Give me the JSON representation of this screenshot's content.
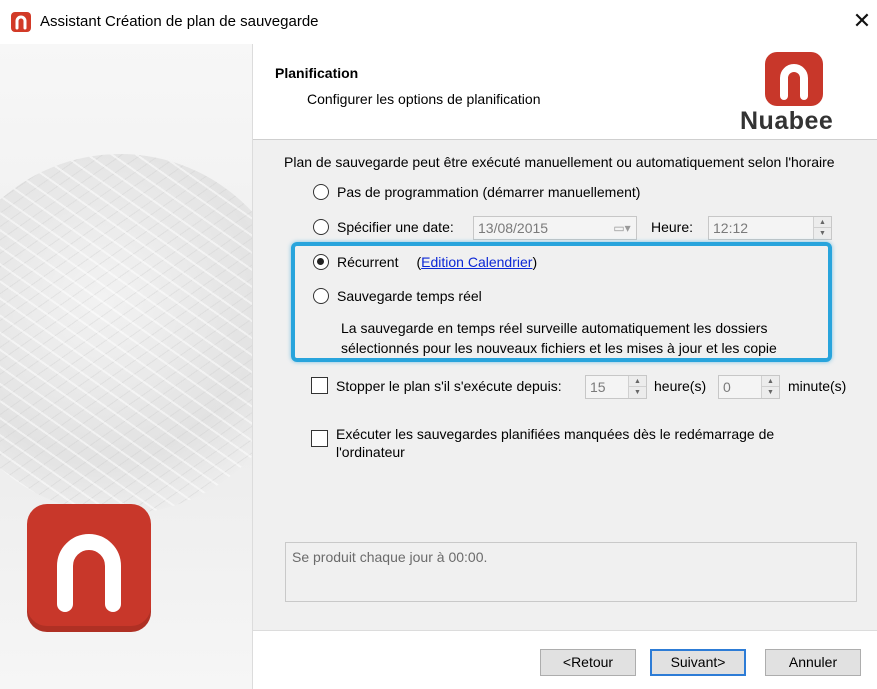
{
  "window": {
    "title": "Assistant Création de plan de sauvegarde",
    "close_glyph": "✕"
  },
  "header": {
    "title": "Planification",
    "subtitle": "Configurer les options de planification",
    "brand": "Nuabee"
  },
  "intro": "Plan de sauvegarde peut être exécuté manuellement ou automatiquement selon l'horaire",
  "options": {
    "manual": {
      "label": "Pas de programmation (démarrer manuellement)",
      "checked": false
    },
    "date": {
      "label": "Spécifier une date:",
      "date_value": "13/08/2015",
      "time_label": "Heure:",
      "time_value": "12:12",
      "checked": false
    },
    "recurrent": {
      "label": "Récurrent",
      "link_open": "(",
      "link": "Edition Calendrier",
      "link_close": ")",
      "checked": true
    },
    "realtime": {
      "label": "Sauvegarde temps réel",
      "description": "La sauvegarde en temps réel surveille automatiquement les dossiers sélectionnés pour les nouveaux fichiers et les mises à jour et les copie",
      "checked": false
    }
  },
  "stop_plan": {
    "label": "Stopper le plan s'il s'exécute depuis:",
    "hours_value": "15",
    "hours_unit": "heure(s)",
    "minutes_value": "0",
    "minutes_unit": "minute(s)",
    "checked": false
  },
  "missed": {
    "label": "Exécuter les sauvegardes planifiées manquées dès le redémarrage de l'ordinateur",
    "checked": false
  },
  "summary": "Se produit chaque jour à 00:00.",
  "buttons": {
    "back": "<Retour",
    "next": "Suivant>",
    "cancel": "Annuler"
  },
  "colors": {
    "brand": "#c8372a",
    "highlight": "#28a4dc",
    "link": "#0b27d6"
  },
  "icons": {
    "app": "nuabee-logo-icon",
    "calendar": "calendar-dropdown-icon",
    "spin": "spin-up-down-icon"
  }
}
